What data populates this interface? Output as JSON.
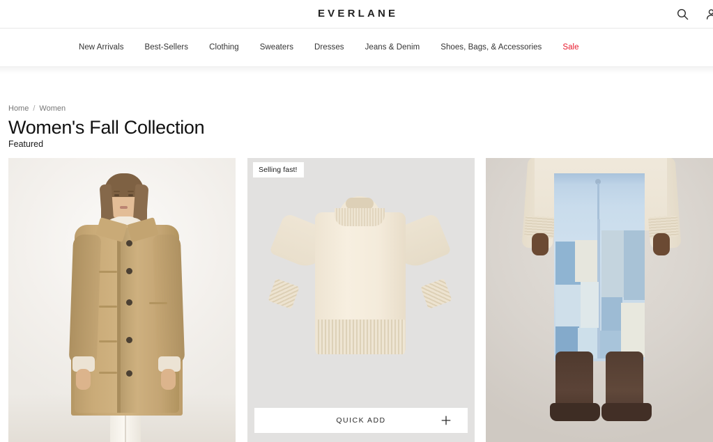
{
  "header": {
    "logo": "EVERLANE",
    "icons": {
      "search": "search-icon",
      "account": "account-icon"
    }
  },
  "nav": {
    "items": [
      {
        "label": "New Arrivals",
        "sale": false
      },
      {
        "label": "Best-Sellers",
        "sale": false
      },
      {
        "label": "Clothing",
        "sale": false
      },
      {
        "label": "Sweaters",
        "sale": false
      },
      {
        "label": "Dresses",
        "sale": false
      },
      {
        "label": "Jeans & Denim",
        "sale": false
      },
      {
        "label": "Shoes, Bags, & Accessories",
        "sale": false
      },
      {
        "label": "Sale",
        "sale": true
      }
    ],
    "sale_color": "#e8192c"
  },
  "breadcrumb": {
    "home": "Home",
    "separator": "/",
    "current": "Women"
  },
  "main": {
    "title": "Women's Fall Collection",
    "section_label": "Featured"
  },
  "products": [
    {
      "name": "trench-coat-on-model",
      "badge": null,
      "quick_add": null,
      "background": "#f4f2ef"
    },
    {
      "name": "cream-mock-neck-sweater",
      "badge": "Selling fast!",
      "quick_add": "QUICK ADD",
      "quick_add_icon": "plus-icon",
      "background": "#e2e1e0"
    },
    {
      "name": "patchwork-jeans-on-model",
      "badge": null,
      "quick_add": null,
      "background": "#d7d3cf"
    }
  ],
  "colors": {
    "text": "#1a1a1a",
    "muted": "#767676",
    "border": "#e8e8e8",
    "accent": "#e8192c"
  }
}
